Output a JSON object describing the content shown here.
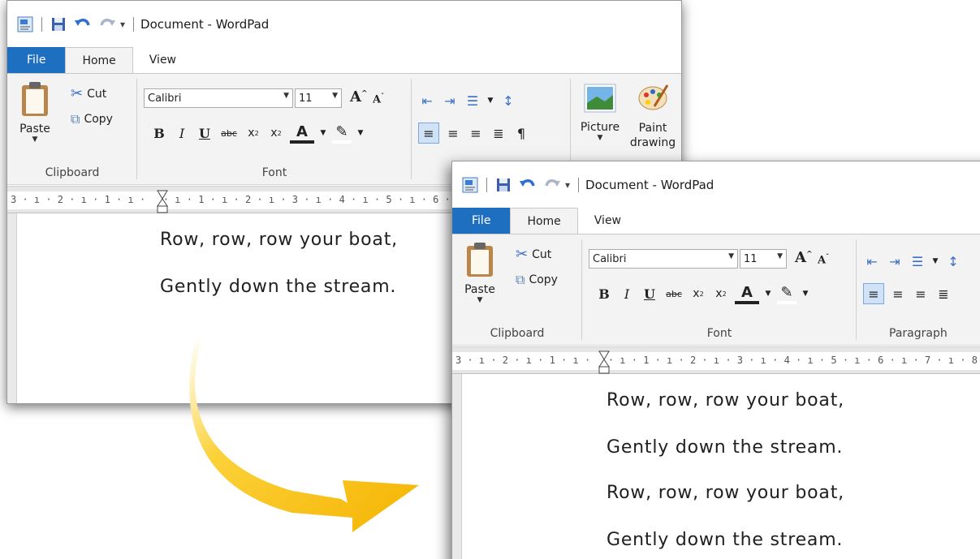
{
  "window_back": {
    "title": "Document - WordPad",
    "tabs": [
      "File",
      "Home",
      "View"
    ],
    "clipboard": {
      "paste_label": "Paste",
      "cut_label": "Cut",
      "copy_label": "Copy",
      "group_label": "Clipboard"
    },
    "font": {
      "name": "Calibri",
      "size": "11",
      "group_label": "Font"
    },
    "insert": {
      "picture_label": "Picture",
      "paint_label": "Paint",
      "paint_label2": "drawing"
    },
    "ruler_text": "3 · ı · 2 · ı · 1 · ı ·   · ı · 1 · ı · 2 · ı · 3 · ı · 4 · ı · 5 · ı · 6 ·",
    "doc_lines": [
      "Row, row, row your boat,",
      "Gently down the stream."
    ]
  },
  "window_front": {
    "title": "Document - WordPad",
    "tabs": [
      "File",
      "Home",
      "View"
    ],
    "clipboard": {
      "paste_label": "Paste",
      "cut_label": "Cut",
      "copy_label": "Copy",
      "group_label": "Clipboard"
    },
    "font": {
      "name": "Calibri",
      "size": "11",
      "group_label": "Font"
    },
    "paragraph": {
      "group_label": "Paragraph"
    },
    "ruler_text": "3 · ı · 2 · ı · 1 · ı ·   · ı · 1 · ı · 2 · ı · 3 · ı · 4 · ı · 5 · ı · 6 · ı · 7 · ı · 8",
    "doc_lines": [
      "Row, row, row your boat,",
      "Gently down the stream.",
      "Row, row, row your boat,",
      "Gently down the stream."
    ]
  },
  "icons": {
    "app": "wordpad-app-icon",
    "save": "save-icon",
    "undo": "undo-icon",
    "redo": "redo-icon",
    "customize": "customize-toolbar-icon",
    "arrow": "transition-arrow"
  },
  "colors": {
    "file_tab": "#1e6fc0",
    "arrow": "#f7b800",
    "ribbon_bg": "#f3f3f3"
  }
}
